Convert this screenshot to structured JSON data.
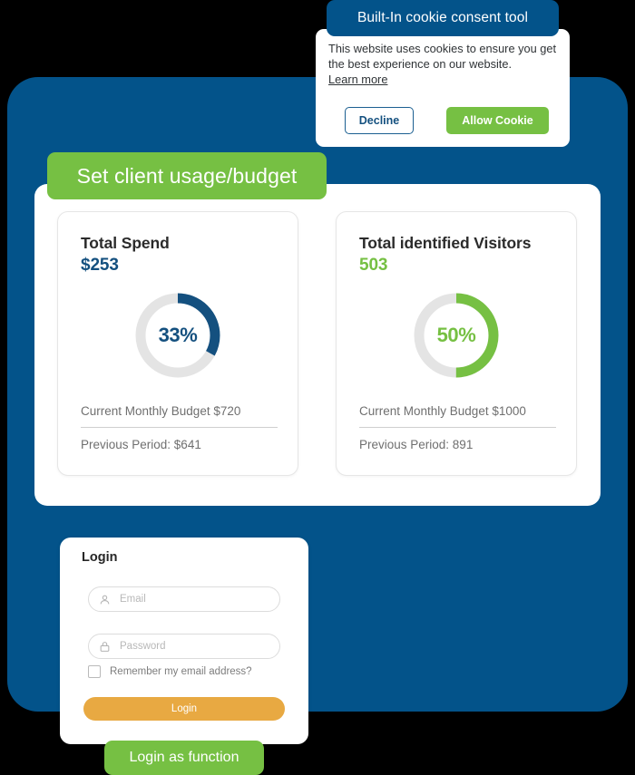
{
  "cookie_consent": {
    "header": "Built-In cookie consent tool",
    "body": "This website uses cookies to ensure you get the best experience on our website.",
    "learn_more": "Learn more",
    "decline_label": "Decline",
    "allow_label": "Allow Cookie"
  },
  "section_badge": {
    "label": "Set client usage/budget"
  },
  "cards": [
    {
      "title": "Total Spend",
      "value": "$253",
      "percent_label": "33%",
      "percent": 33,
      "accent": "#14507F",
      "budget_row": "Current Monthly Budget $720",
      "previous_row": "Previous Period: $641"
    },
    {
      "title": "Total identified Visitors",
      "value": "503",
      "percent_label": "50%",
      "percent": 50,
      "accent": "#76C043",
      "budget_row": "Current Monthly Budget $1000",
      "previous_row": "Previous Period: 891"
    }
  ],
  "login": {
    "title": "Login",
    "email_placeholder": "Email",
    "email_value": "",
    "password_placeholder": "Password",
    "password_value": "",
    "remember_label": "Remember my email address?",
    "remember_checked": false,
    "submit_label": "Login"
  },
  "cta": {
    "label": "Login as function"
  },
  "colors": {
    "brand_blue": "#03538A",
    "brand_green": "#76C043",
    "accent_orange": "#E8A942",
    "track_gray": "#E4E4E4"
  }
}
